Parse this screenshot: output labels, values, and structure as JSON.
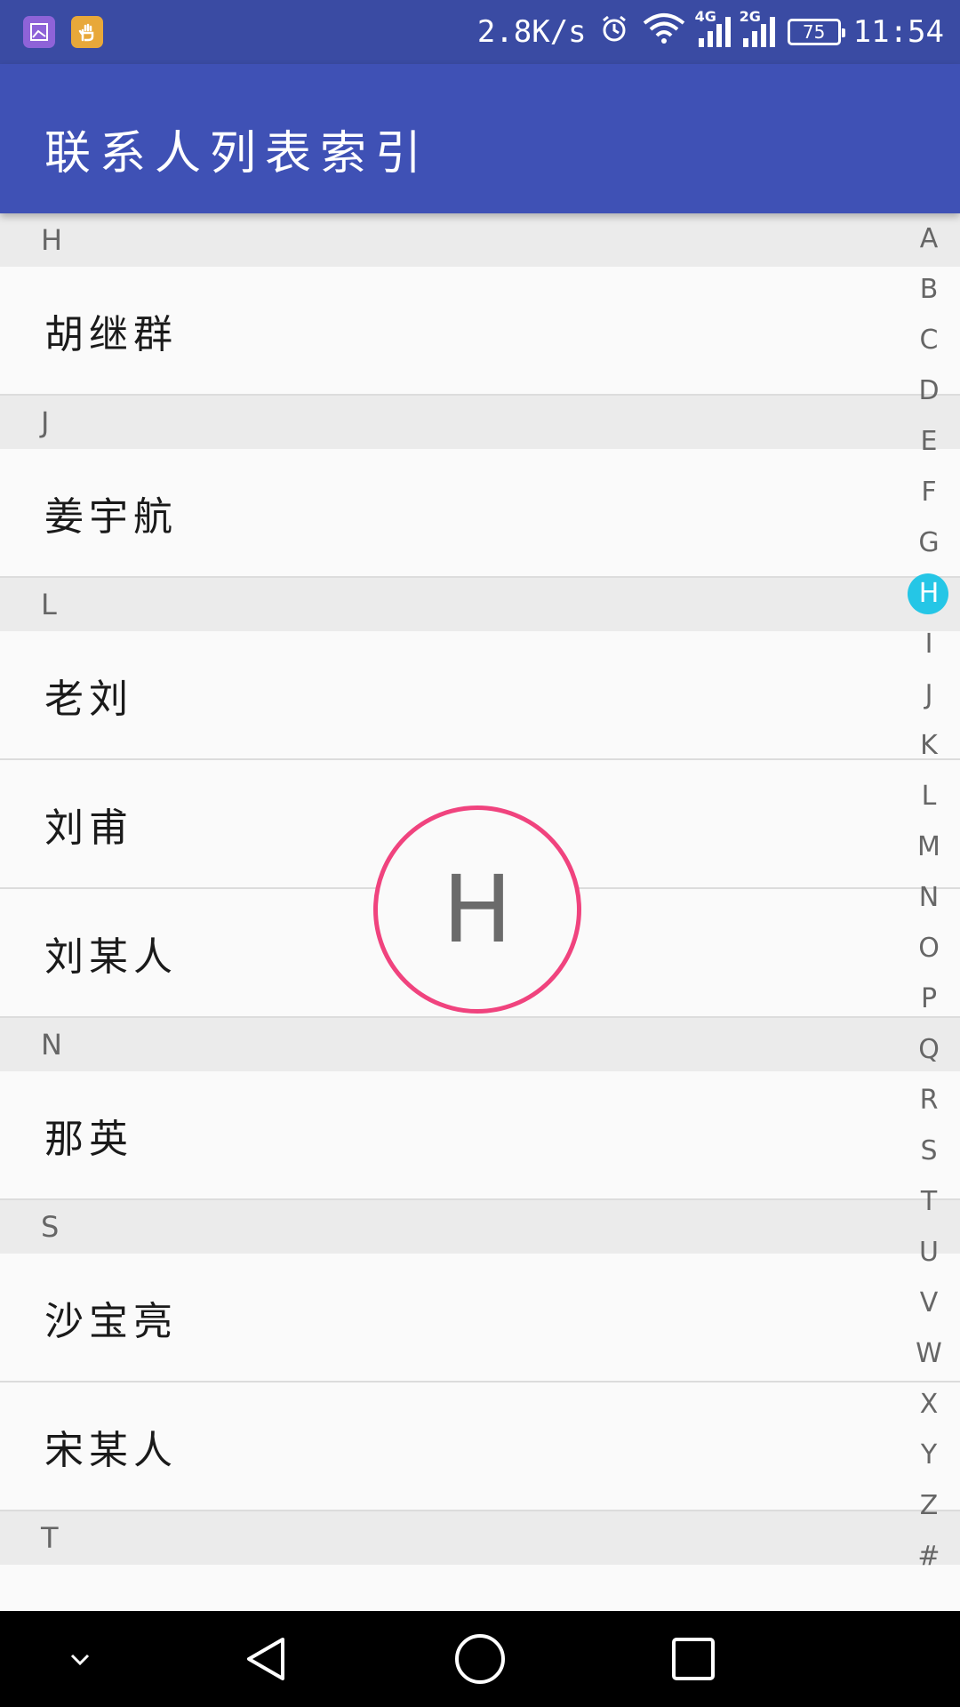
{
  "status_bar": {
    "network_speed": "2.8K/s",
    "signal1_label": "4G",
    "signal2_label": "2G",
    "battery": "75",
    "time": "11:54"
  },
  "app_bar": {
    "title": "联系人列表索引"
  },
  "list": {
    "sections": [
      {
        "letter": "H",
        "contacts": [
          "胡继群"
        ]
      },
      {
        "letter": "J",
        "contacts": [
          "姜宇航"
        ]
      },
      {
        "letter": "L",
        "contacts": [
          "老刘",
          "刘甫",
          "刘某人"
        ]
      },
      {
        "letter": "N",
        "contacts": [
          "那英"
        ]
      },
      {
        "letter": "S",
        "contacts": [
          "沙宝亮",
          "宋某人"
        ]
      },
      {
        "letter": "T",
        "contacts": []
      }
    ]
  },
  "index_bar": {
    "letters": [
      "A",
      "B",
      "C",
      "D",
      "E",
      "F",
      "G",
      "H",
      "I",
      "J",
      "K",
      "L",
      "M",
      "N",
      "O",
      "P",
      "Q",
      "R",
      "S",
      "T",
      "U",
      "V",
      "W",
      "X",
      "Y",
      "Z",
      "#"
    ],
    "selected": "H"
  },
  "overlay": {
    "letter": "H"
  },
  "colors": {
    "status_bar": "#3a4ba3",
    "app_bar": "#3f51b5",
    "index_highlight": "#25c6e6",
    "overlay_ring": "#f0437e"
  }
}
